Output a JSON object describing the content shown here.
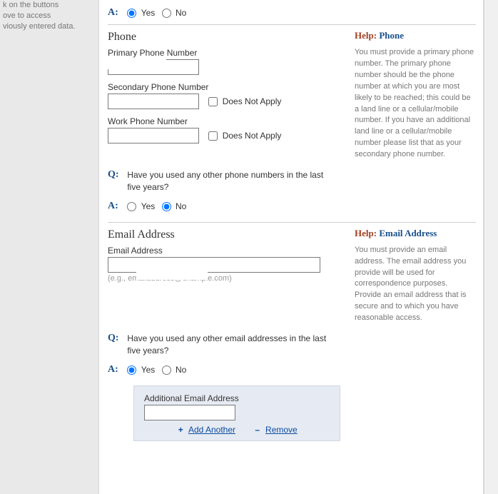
{
  "leftnote": [
    "k on the buttons",
    "ove to access",
    "viously entered data."
  ],
  "qa_top": {
    "a": "A:",
    "yes": "Yes",
    "no": "No",
    "selected": "yes"
  },
  "phone": {
    "section_title": "Phone",
    "help_word": "Help:",
    "help_topic": "Phone",
    "help_text": "You must provide a primary phone number. The primary phone number should be the phone number at which you are most likely to be reached; this could be a land line or a cellular/mobile number. If you have an additional land line or a cellular/mobile number please list that as your secondary phone number.",
    "primary_label": "Primary Phone Number",
    "primary_value": "",
    "secondary_label": "Secondary Phone Number",
    "secondary_value": "",
    "secondary_dna": "Does Not Apply",
    "work_label": "Work Phone Number",
    "work_value": "",
    "work_dna": "Does Not Apply",
    "q": "Q:",
    "q_text": "Have you used any other phone numbers in the last five years?",
    "a": "A:",
    "yes": "Yes",
    "no": "No",
    "selected": "no"
  },
  "email": {
    "section_title": "Email Address",
    "help_word": "Help:",
    "help_topic": "Email Address",
    "help_text": "You must provide an email address.  The email address you provide will be used for correspondence purposes.  Provide an email address that is secure and to which you have reasonable access.",
    "label": "Email Address",
    "value": "",
    "hint": "(e.g., emailaddress@example.com)",
    "q": "Q:",
    "q_text": "Have you used any other email addresses in the last five years?",
    "a": "A:",
    "yes": "Yes",
    "no": "No",
    "selected": "yes",
    "additional_label": "Additional Email Address",
    "additional_value": "",
    "add_sign": "+",
    "add": "Add Another",
    "remove_sign": "–",
    "remove": "Remove"
  }
}
